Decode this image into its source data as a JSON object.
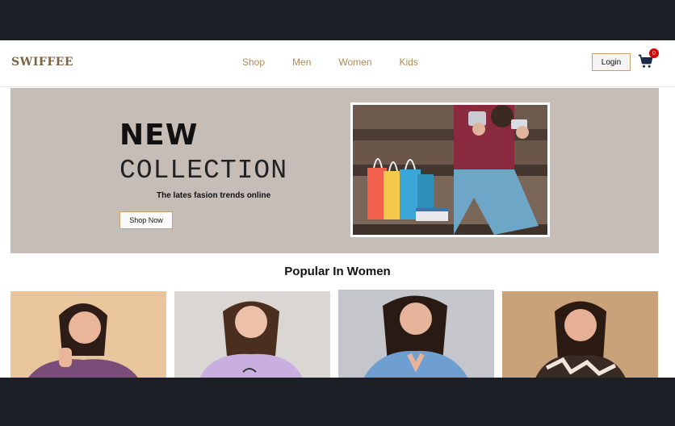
{
  "brand": {
    "logo": "SWIFFEE"
  },
  "nav": {
    "items": [
      "Shop",
      "Men",
      "Women",
      "Kids"
    ]
  },
  "header": {
    "login_label": "Login",
    "cart_count": "0"
  },
  "hero": {
    "title_line1": "NEW",
    "title_line2": "COLLECTION",
    "subtitle": "The lates fasion trends online",
    "cta_label": "Shop Now"
  },
  "section": {
    "title": "Popular In Women"
  },
  "colors": {
    "accent": "#b08a55",
    "hero_bg": "#c6bdb7",
    "badge": "#d40000",
    "chrome": "#1c1f26"
  }
}
